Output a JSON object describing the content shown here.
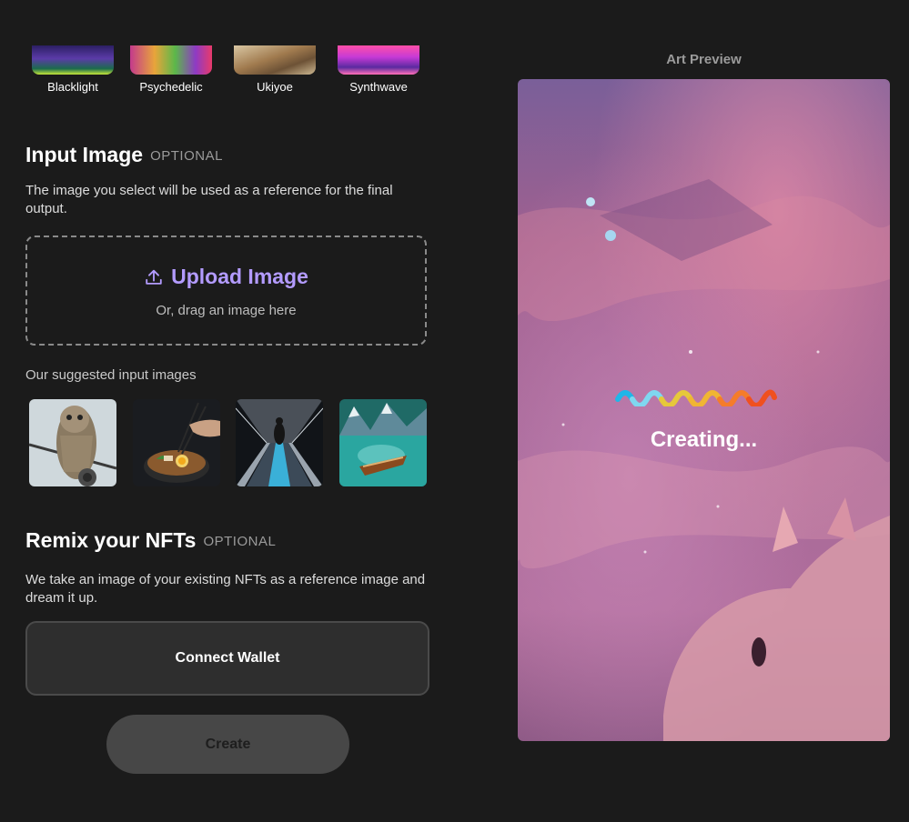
{
  "styles": [
    {
      "label": "Blacklight"
    },
    {
      "label": "Psychedelic"
    },
    {
      "label": "Ukiyoe"
    },
    {
      "label": "Synthwave"
    }
  ],
  "input_image": {
    "title": "Input Image",
    "optional": "OPTIONAL",
    "description": "The image you select will be used as a reference for the final output.",
    "upload_label": "Upload Image",
    "upload_sub": "Or, drag an image here",
    "upload_icon": "upload-icon",
    "suggested_label": "Our suggested input images",
    "suggested": [
      {
        "name": "owl-on-wire"
      },
      {
        "name": "ramen-chopsticks"
      },
      {
        "name": "escalator-tunnel"
      },
      {
        "name": "boat-on-lake"
      }
    ]
  },
  "remix": {
    "title": "Remix your NFTs",
    "optional": "OPTIONAL",
    "description": "We take an image of your existing NFTs as a reference image and dream it up.",
    "connect_label": "Connect Wallet"
  },
  "create_label": "Create",
  "preview": {
    "title": "Art Preview",
    "status": "Creating...",
    "loader_colors": [
      "#1fb6e8",
      "#7fd7f0",
      "#e6c83a",
      "#f0b533",
      "#f57c2a",
      "#f0501f"
    ]
  }
}
